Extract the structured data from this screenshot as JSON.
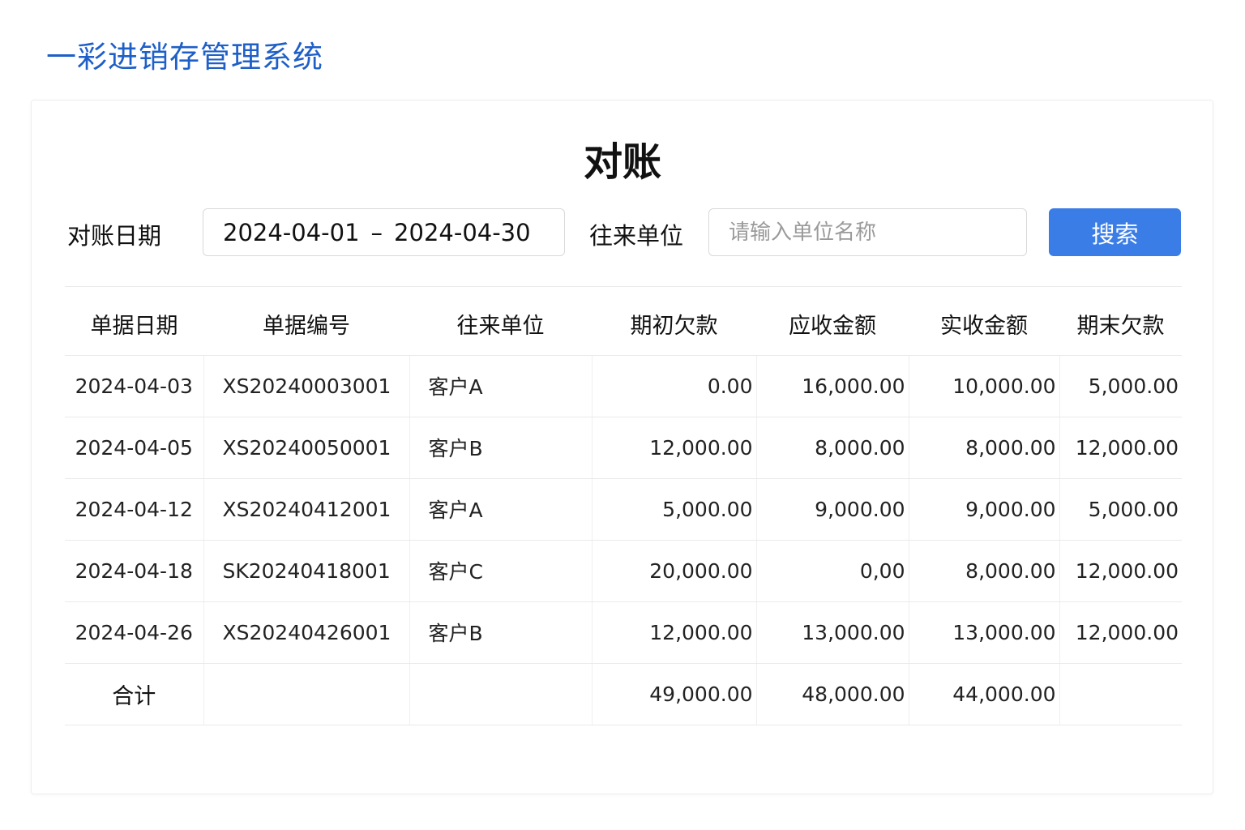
{
  "app_title": "一彩进销存管理系统",
  "page_title": "对账",
  "filters": {
    "date_label": "对账日期",
    "date_start": "2024-04-01",
    "date_sep": "–",
    "date_end": "2024-04-30",
    "party_label": "往来单位",
    "party_placeholder": "请输入单位名称",
    "search_label": "搜索"
  },
  "table": {
    "columns": [
      "单据日期",
      "单据编号",
      "往来单位",
      "期初欠款",
      "应收金额",
      "实收金额",
      "期末欠款"
    ],
    "rows": [
      [
        "2024-04-03",
        "XS20240003001",
        "客户A",
        "0.00",
        "16,000.00",
        "10,000.00",
        "5,000.00"
      ],
      [
        "2024-04-05",
        "XS20240050001",
        "客户B",
        "12,000.00",
        "8,000.00",
        "8,000.00",
        "12,000.00"
      ],
      [
        "2024-04-12",
        "XS20240412001",
        "客户A",
        "5,000.00",
        "9,000.00",
        "9,000.00",
        "5,000.00"
      ],
      [
        "2024-04-18",
        "SK20240418001",
        "客户C",
        "20,000.00",
        "0,00",
        "8,000.00",
        "12,000.00"
      ],
      [
        "2024-04-26",
        "XS20240426001",
        "客户B",
        "12,000.00",
        "13,000.00",
        "13,000.00",
        "12,000.00"
      ]
    ],
    "total": {
      "label": "合计",
      "opening": "49,000.00",
      "receivable": "48,000.00",
      "received": "44,000.00"
    }
  },
  "colors": {
    "accent": "#3a7de6",
    "title": "#1e5fc8"
  }
}
